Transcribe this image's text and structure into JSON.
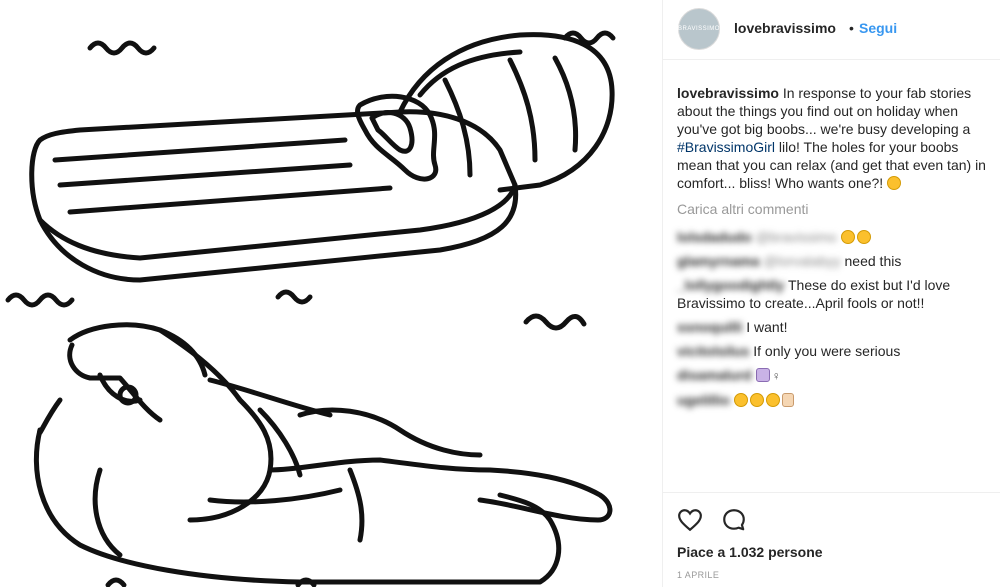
{
  "post": {
    "image_alt": "Line drawing of a lilo with chest holes and a woman lying on a lilo"
  },
  "header": {
    "username": "lovebravissimo",
    "separator": "•",
    "follow_label": "Segui",
    "avatar_text": "BRAVISSIMO"
  },
  "caption": {
    "username": "lovebravissimo",
    "text_before": " In response to your fab stories about the things you find out on holiday when you've got big boobs... we're busy developing a ",
    "hashtag": "#BravissimoGirl",
    "text_after": " lilo! The holes for your boobs mean that you can relax (and get that even tan) in comfort... bliss! Who wants one?!"
  },
  "load_more_label": "Carica altri commenti",
  "comments": [
    {
      "user": "lolsdadudo",
      "mention": "@bravissimo",
      "text": ""
    },
    {
      "user": "glamyrnama",
      "mention": "@lorvalabyy",
      "text": " need this"
    },
    {
      "user": "_lollygoodightly",
      "mention": "",
      "text": " These do exist but I'd love Bravissimo to create...April fools or not!!"
    },
    {
      "user": "ssnoquilli",
      "mention": "",
      "text": " I want!"
    },
    {
      "user": "vicitolsilus",
      "mention": "",
      "text": " If only you were serious"
    },
    {
      "user": "disamalurd",
      "mention": "",
      "text": ""
    },
    {
      "user": "ugelillio",
      "mention": "",
      "text": ""
    }
  ],
  "female_sign": "♀",
  "actions": {
    "likes_text": "Piace a 1.032 persone",
    "date_text": "1 APRILE"
  },
  "icons": {
    "like": "heart-icon",
    "comment": "speech-bubble-icon",
    "emoji": "emoji-icon"
  },
  "colors": {
    "link_blue": "#3897f0",
    "hashtag_blue": "#003569",
    "muted": "#999999",
    "text": "#262626"
  }
}
